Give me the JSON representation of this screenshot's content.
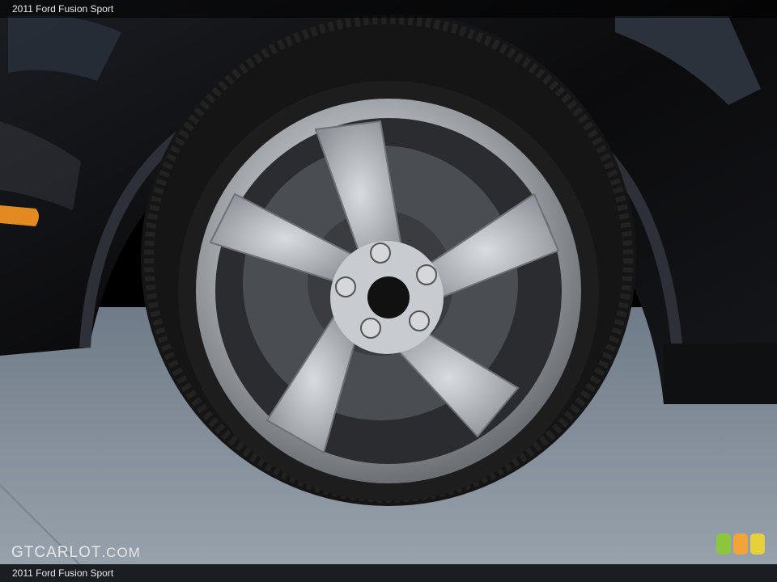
{
  "caption_top": "2011 Ford Fusion Sport",
  "caption_bottom": "2011 Ford Fusion Sport",
  "watermark": {
    "brand": "GTCARLOT",
    "suffix": ".COM"
  },
  "colors": {
    "car_paint": "#0d0d0f",
    "ground": "#8d97a3",
    "rim": "#b9bdc2",
    "tire": "#151515",
    "logo_green": "#8cc63f",
    "logo_orange": "#f2a33a",
    "logo_yellow": "#e6d13d"
  }
}
